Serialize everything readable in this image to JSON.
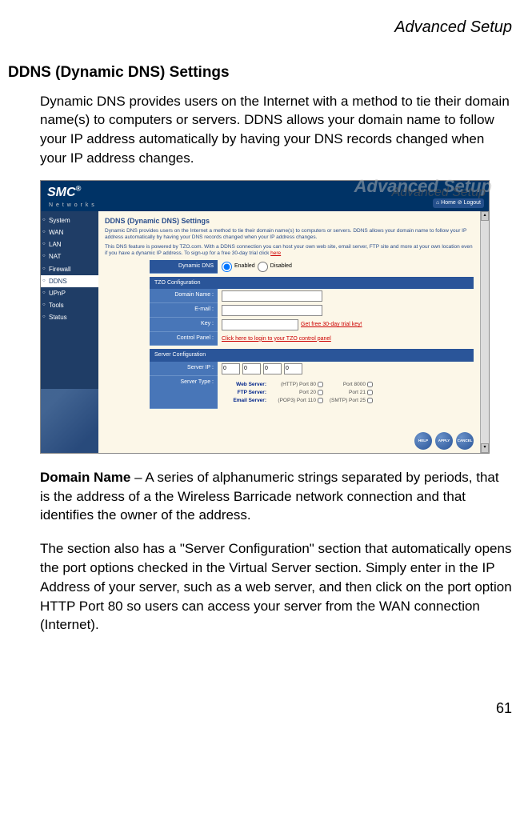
{
  "header": {
    "right_label": "Advanced Setup"
  },
  "section": {
    "title": "DDNS (Dynamic DNS) Settings",
    "intro": "Dynamic DNS provides users on the Internet with a method to tie their domain name(s) to computers or servers. DDNS allows your domain name to follow your IP address automatically by having your DNS records changed when your IP address changes."
  },
  "screenshot": {
    "logo": "SMC",
    "logo_reg": "®",
    "logo_sub": "N e t w o r k s",
    "watermark_big": "Advanced Setup",
    "watermark": "Advanced Setup",
    "home_logout": "⌂ Home   ⊘ Logout",
    "nav": [
      {
        "label": "System"
      },
      {
        "label": "WAN"
      },
      {
        "label": "LAN"
      },
      {
        "label": "NAT"
      },
      {
        "label": "Firewall"
      },
      {
        "label": "DDNS",
        "highlight": true
      },
      {
        "label": "UPnP"
      },
      {
        "label": "Tools"
      },
      {
        "label": "Status"
      }
    ],
    "main_title": "DDNS (Dynamic DNS) Settings",
    "desc1": "Dynamic DNS provides users on the Internet a method to tie their domain name(s) to computers or servers. DDNS allows your domain name to follow your IP address automatically by having your DNS records changed when your IP address changes.",
    "desc2_pre": "This DNS feature is powered by TZO.com. With a DDNS connection you can host your own web site, email server, FTP site and more at your own location even if you have a dynamic IP address. To sign-up for a free 30-day trial click ",
    "desc2_link": "here",
    "ddns_row": {
      "label": "Dynamic DNS",
      "enabled": "Enabled",
      "disabled": "Disabled"
    },
    "tzo_head": "TZO Configuration",
    "tzo_rows": {
      "domain": "Domain Name :",
      "email": "E-mail :",
      "key": "Key :",
      "key_link": "Get free 30-day trial key!",
      "control": "Control Panel :",
      "control_link": "Click here to  login to your TZO  control panel"
    },
    "server_head": "Server Configuration",
    "server_ip_label": "Server IP :",
    "server_ip": [
      "0",
      "0",
      "0",
      "0"
    ],
    "server_type_label": "Server Type :",
    "server_lines": [
      {
        "name": "Web Server:",
        "p1": "(HTTP) Port 80",
        "p2": "Port 8000"
      },
      {
        "name": "FTP Server:",
        "p1": "Port 20",
        "p2": "Port 21"
      },
      {
        "name": "Email Server:",
        "p1": "(POP3) Port 110",
        "p2": "(SMTP) Port 25"
      }
    ],
    "buttons": [
      "HELP",
      "APPLY",
      "CANCEL"
    ]
  },
  "domain_name_para_label": "Domain Name",
  "domain_name_para": " – A series of alphanumeric strings separated by periods, that is the address of a the Wireless Barricade network connection and that identifies the owner of the address.",
  "server_config_para": "The section also has a \"Server Configuration\" section that automatically opens the port options checked in the Virtual Server section. Simply enter in the IP Address of your server, such as a web server, and then click on the port option HTTP Port 80 so users can access your server from the WAN connection (Internet).",
  "page_number": "61"
}
